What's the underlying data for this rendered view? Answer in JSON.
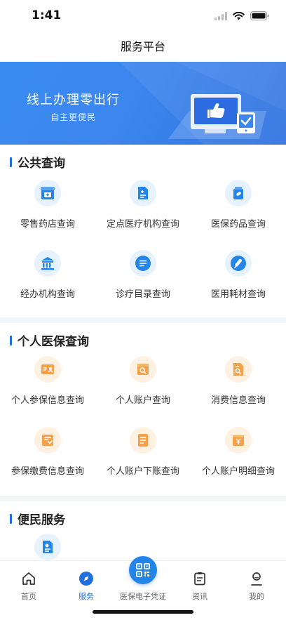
{
  "status": {
    "time": "1:41"
  },
  "nav": {
    "title": "服务平台"
  },
  "banner": {
    "title": "线上办理零出行",
    "subtitle": "自主更便民"
  },
  "sections": [
    {
      "title": "公共查询",
      "items": [
        {
          "label": "零售药店查询",
          "icon": "pharmacy-icon"
        },
        {
          "label": "定点医疗机构查询",
          "icon": "medical-doc-icon"
        },
        {
          "label": "医保药品查询",
          "icon": "medicine-icon"
        },
        {
          "label": "经办机构查询",
          "icon": "building-icon"
        },
        {
          "label": "诊疗目录查询",
          "icon": "list-icon"
        },
        {
          "label": "医用耗材查询",
          "icon": "syringe-icon"
        }
      ]
    },
    {
      "title": "个人医保查询",
      "items": [
        {
          "label": "个人参保信息查询",
          "icon": "id-card-icon"
        },
        {
          "label": "个人账户查询",
          "icon": "account-search-icon"
        },
        {
          "label": "消费信息查询",
          "icon": "doc-search-icon"
        },
        {
          "label": "参保缴费信息查询",
          "icon": "payment-doc-icon"
        },
        {
          "label": "个人账户下账查询",
          "icon": "ledger-icon"
        },
        {
          "label": "个人账户明细查询",
          "icon": "yen-wallet-icon"
        }
      ]
    },
    {
      "title": "便民服务",
      "items": [
        {
          "label": "",
          "icon": "location-doc-icon"
        }
      ]
    }
  ],
  "tabbar": {
    "items": [
      {
        "label": "首页",
        "icon": "home-icon",
        "active": false
      },
      {
        "label": "服务",
        "icon": "compass-icon",
        "active": true
      },
      {
        "label": "医保电子凭证",
        "icon": "qr-code-icon",
        "active": false
      },
      {
        "label": "资讯",
        "icon": "clipboard-icon",
        "active": false
      },
      {
        "label": "我的",
        "icon": "user-icon",
        "active": false
      }
    ]
  },
  "colors": {
    "primary": "#1f6fe0",
    "banner": "#3a8cf2",
    "orange": "#f5a14a",
    "iconBlue": "#2384ea"
  }
}
